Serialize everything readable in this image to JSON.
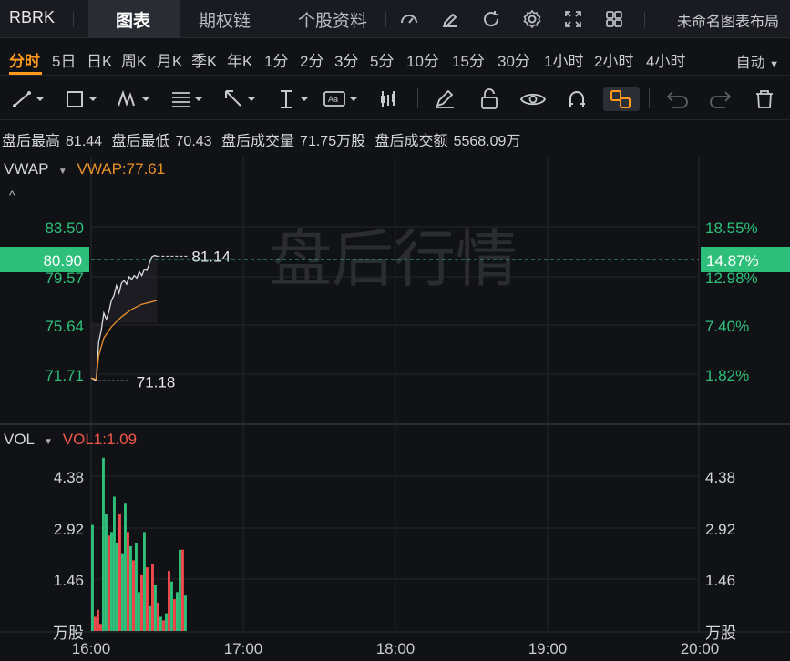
{
  "app": {
    "ticker": "RBRK",
    "tabs": [
      "图表",
      "期权链",
      "个股资料"
    ],
    "layout_name": "未命名图表布局"
  },
  "periods": {
    "items": [
      "分时",
      "5日",
      "日K",
      "周K",
      "月K",
      "季K",
      "年K",
      "1分",
      "2分",
      "3分",
      "5分",
      "10分",
      "15分",
      "30分",
      "1小时",
      "2小时",
      "4小时"
    ],
    "active": "分时",
    "mode": "自动"
  },
  "info_bar": {
    "high_label": "盘后最高",
    "high": "81.44",
    "low_label": "盘后最低",
    "low": "70.43",
    "vol_label": "盘后成交量",
    "vol": "71.75万股",
    "amt_label": "盘后成交额",
    "amt": "5568.09万"
  },
  "price_panel": {
    "indicator": "VWAP",
    "indicator_value": "VWAP:77.61",
    "watermark": "盘后行情",
    "current_price": "80.90",
    "current_pct": "14.87%",
    "last_label": "81.14",
    "start_label": "71.18",
    "left_ticks": [
      "83.50",
      "79.57",
      "75.64",
      "71.71"
    ],
    "right_ticks": [
      "18.55%",
      "12.98%",
      "7.40%",
      "1.82%"
    ]
  },
  "volume_panel": {
    "indicator": "VOL",
    "indicator_value": "VOL1:1.09",
    "left_ticks": [
      "4.38",
      "2.92",
      "1.46"
    ],
    "right_ticks": [
      "4.38",
      "2.92",
      "1.46"
    ],
    "unit": "万股"
  },
  "x_axis": [
    "16:00",
    "17:00",
    "18:00",
    "19:00",
    "20:00"
  ],
  "colors": {
    "up": "#2ec07a",
    "down": "#f0484b",
    "accent": "#ff9a1c",
    "vwap": "#e8922a",
    "price": "#d9dce2"
  },
  "chart_data": {
    "type": "line",
    "price_series": [
      {
        "x": "16:00",
        "y": 71.4
      },
      {
        "x": "16:01",
        "y": 71.3
      },
      {
        "x": "16:02",
        "y": 71.2
      },
      {
        "x": "16:03",
        "y": 74.3
      },
      {
        "x": "16:04",
        "y": 75.2
      },
      {
        "x": "16:05",
        "y": 76.6
      },
      {
        "x": "16:06",
        "y": 76.1
      },
      {
        "x": "16:07",
        "y": 76.7
      },
      {
        "x": "16:08",
        "y": 77.6
      },
      {
        "x": "16:09",
        "y": 78.0
      },
      {
        "x": "16:10",
        "y": 78.8
      },
      {
        "x": "16:11",
        "y": 78.2
      },
      {
        "x": "16:12",
        "y": 79.0
      },
      {
        "x": "16:13",
        "y": 79.2
      },
      {
        "x": "16:14",
        "y": 78.9
      },
      {
        "x": "16:15",
        "y": 79.5
      },
      {
        "x": "16:16",
        "y": 79.3
      },
      {
        "x": "16:17",
        "y": 79.6
      },
      {
        "x": "16:18",
        "y": 79.4
      },
      {
        "x": "16:19",
        "y": 79.9
      },
      {
        "x": "16:20",
        "y": 79.6
      },
      {
        "x": "16:21",
        "y": 80.1
      },
      {
        "x": "16:22",
        "y": 80.0
      },
      {
        "x": "16:23",
        "y": 80.6
      },
      {
        "x": "16:24",
        "y": 81.1
      },
      {
        "x": "16:25",
        "y": 81.2
      },
      {
        "x": "16:26",
        "y": 81.14
      }
    ],
    "vwap_series": [
      {
        "x": "16:00",
        "y": 71.4
      },
      {
        "x": "16:02",
        "y": 71.3
      },
      {
        "x": "16:03",
        "y": 73.2
      },
      {
        "x": "16:05",
        "y": 74.6
      },
      {
        "x": "16:08",
        "y": 75.5
      },
      {
        "x": "16:12",
        "y": 76.3
      },
      {
        "x": "16:16",
        "y": 76.9
      },
      {
        "x": "16:20",
        "y": 77.3
      },
      {
        "x": "16:24",
        "y": 77.5
      },
      {
        "x": "16:26",
        "y": 77.61
      }
    ],
    "volume_bars": [
      {
        "v": 3.0,
        "up": true
      },
      {
        "v": 0.4,
        "up": false
      },
      {
        "v": 0.6,
        "up": false
      },
      {
        "v": 0.2,
        "up": false
      },
      {
        "v": 4.9,
        "up": true
      },
      {
        "v": 3.3,
        "up": true
      },
      {
        "v": 2.7,
        "up": false
      },
      {
        "v": 2.8,
        "up": true
      },
      {
        "v": 3.8,
        "up": true
      },
      {
        "v": 2.5,
        "up": true
      },
      {
        "v": 3.3,
        "up": false
      },
      {
        "v": 2.2,
        "up": true
      },
      {
        "v": 3.6,
        "up": true
      },
      {
        "v": 2.8,
        "up": false
      },
      {
        "v": 2.4,
        "up": true
      },
      {
        "v": 2.0,
        "up": false
      },
      {
        "v": 2.5,
        "up": true
      },
      {
        "v": 1.1,
        "up": true
      },
      {
        "v": 1.6,
        "up": false
      },
      {
        "v": 2.8,
        "up": true
      },
      {
        "v": 1.8,
        "up": false
      },
      {
        "v": 0.7,
        "up": true
      },
      {
        "v": 1.9,
        "up": false
      },
      {
        "v": 1.3,
        "up": true
      },
      {
        "v": 0.8,
        "up": false
      },
      {
        "v": 0.4,
        "up": true
      },
      {
        "v": 0.3,
        "up": false
      },
      {
        "v": 0.5,
        "up": true
      },
      {
        "v": 1.7,
        "up": false
      },
      {
        "v": 1.4,
        "up": true
      },
      {
        "v": 0.9,
        "up": false
      },
      {
        "v": 1.1,
        "up": true
      },
      {
        "v": 2.3,
        "up": true
      },
      {
        "v": 2.3,
        "up": false
      },
      {
        "v": 1.0,
        "up": true
      }
    ],
    "price_range": [
      70.43,
      81.44
    ],
    "volume_unit": "万股"
  }
}
